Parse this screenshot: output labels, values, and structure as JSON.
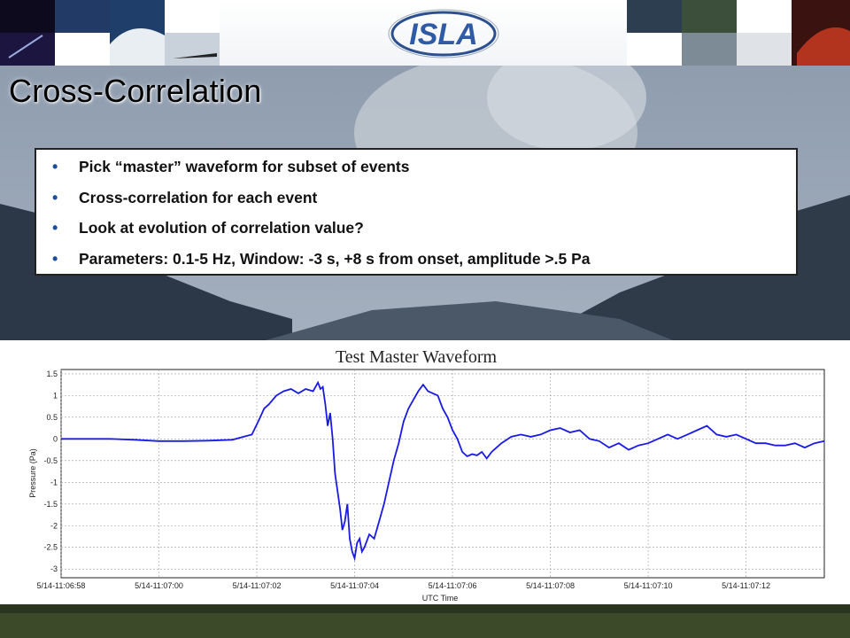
{
  "slide": {
    "title": "Cross-Correlation",
    "logo_text": "ISLA",
    "bullets": [
      "Pick “master” waveform for subset of events",
      "Cross-correlation for each event",
      "Look at evolution of correlation value?",
      "Parameters: 0.1-5 Hz, Window: -3 s, +8 s from onset, amplitude >.5 Pa"
    ],
    "colors": {
      "bullet": "#1a4f9f",
      "line": "#1a1ae6",
      "sky": "#7b8ca2",
      "mountain": "#2e3b4a"
    }
  },
  "chart_data": {
    "type": "line",
    "title": "Test Master Waveform",
    "xlabel": "UTC Time",
    "ylabel": "Pressure (Pa)",
    "xlim": [
      58,
      73.6
    ],
    "ylim": [
      -3.2,
      1.6
    ],
    "grid": true,
    "x_ticks": [
      58,
      60,
      62,
      64,
      66,
      68,
      70,
      72
    ],
    "x_tick_labels": [
      "5/14-11:06:58",
      "5/14-11:07:00",
      "5/14-11:07:02",
      "5/14-11:07:04",
      "5/14-11:07:06",
      "5/14-11:07:08",
      "5/14-11:07:10",
      "5/14-11:07:12"
    ],
    "y_ticks": [
      1.5,
      1,
      0.5,
      0,
      -0.5,
      -1,
      -1.5,
      -2,
      -2.5,
      -3
    ],
    "y_tick_labels": [
      "1.5",
      "1",
      "0.5",
      "0",
      "-0.5",
      "-1",
      "-1.5",
      "-2",
      "-2.5",
      "-3"
    ],
    "series": [
      {
        "x": [
          58.0,
          58.5,
          59.0,
          59.5,
          60.0,
          60.5,
          61.0,
          61.5,
          61.9,
          62.05,
          62.15,
          62.25,
          62.4,
          62.55,
          62.7,
          62.85,
          63.0,
          63.15,
          63.25,
          63.3,
          63.35,
          63.4,
          63.45,
          63.5,
          63.55,
          63.6,
          63.65,
          63.7,
          63.75,
          63.8,
          63.85,
          63.9,
          63.95,
          64.0,
          64.05,
          64.1,
          64.15,
          64.2,
          64.3,
          64.4,
          64.5,
          64.6,
          64.7,
          64.8,
          64.9,
          65.0,
          65.1,
          65.2,
          65.3,
          65.4,
          65.5,
          65.6,
          65.7,
          65.8,
          65.9,
          66.0,
          66.1,
          66.2,
          66.3,
          66.4,
          66.5,
          66.6,
          66.7,
          66.8,
          66.9,
          67.0,
          67.2,
          67.4,
          67.6,
          67.8,
          68.0,
          68.2,
          68.4,
          68.6,
          68.8,
          69.0,
          69.2,
          69.4,
          69.6,
          69.8,
          70.0,
          70.2,
          70.4,
          70.6,
          70.8,
          71.0,
          71.2,
          71.4,
          71.6,
          71.8,
          72.0,
          72.2,
          72.4,
          72.6,
          72.8,
          73.0,
          73.2,
          73.4,
          73.6
        ],
        "y": [
          0.0,
          0.0,
          0.0,
          -0.02,
          -0.05,
          -0.05,
          -0.04,
          -0.02,
          0.1,
          0.45,
          0.7,
          0.8,
          1.0,
          1.1,
          1.15,
          1.05,
          1.15,
          1.1,
          1.3,
          1.15,
          1.2,
          0.8,
          0.3,
          0.6,
          0.0,
          -0.8,
          -1.2,
          -1.6,
          -2.1,
          -1.9,
          -1.5,
          -2.3,
          -2.6,
          -2.75,
          -2.4,
          -2.3,
          -2.6,
          -2.5,
          -2.2,
          -2.3,
          -1.9,
          -1.5,
          -1.0,
          -0.5,
          -0.1,
          0.4,
          0.7,
          0.9,
          1.1,
          1.25,
          1.1,
          1.05,
          1.0,
          0.7,
          0.5,
          0.2,
          0.0,
          -0.3,
          -0.4,
          -0.35,
          -0.38,
          -0.3,
          -0.45,
          -0.3,
          -0.2,
          -0.1,
          0.05,
          0.1,
          0.05,
          0.1,
          0.2,
          0.25,
          0.15,
          0.2,
          0.0,
          -0.05,
          -0.2,
          -0.1,
          -0.25,
          -0.15,
          -0.1,
          0.0,
          0.1,
          0.0,
          0.1,
          0.2,
          0.3,
          0.1,
          0.05,
          0.1,
          0.0,
          -0.1,
          -0.1,
          -0.15,
          -0.15,
          -0.1,
          -0.2,
          -0.1,
          -0.05
        ]
      }
    ]
  }
}
